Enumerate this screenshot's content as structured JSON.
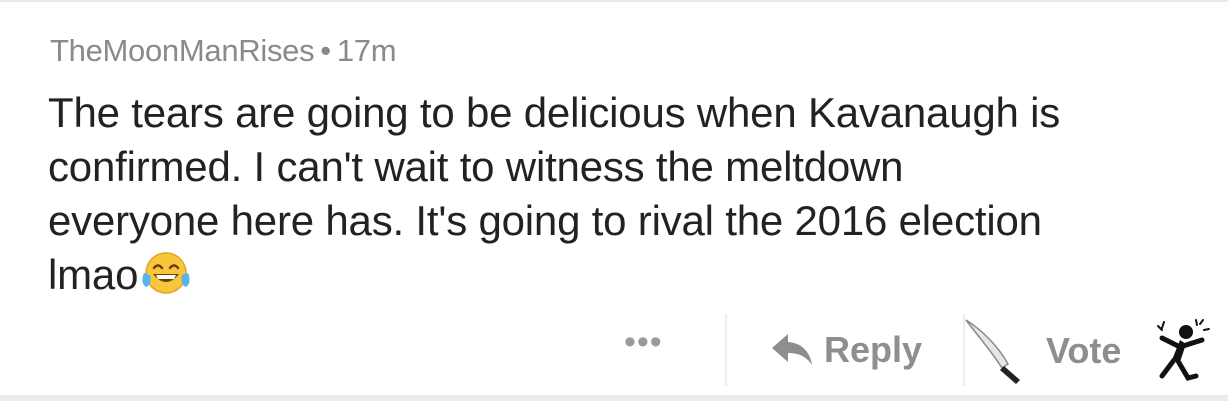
{
  "comment": {
    "author": "TheMoonManRises",
    "separator": "•",
    "age": "17m",
    "body_lines": [
      "The tears are going to be delicious when Kavanaugh is",
      "confirmed. I can't wait to witness the meltdown",
      "everyone here has. It's going to rival the 2016 election",
      "lmao"
    ],
    "emoji": "face-with-tears-of-joy"
  },
  "actions": {
    "more_label": "•••",
    "reply_label": "Reply",
    "vote_label": "Vote",
    "reply_icon": "reply-arrow-icon",
    "upvote_icon": "knife-icon",
    "downvote_icon": "dancing-figure-icon"
  },
  "colors": {
    "text_primary": "#222222",
    "text_meta": "#8a8a8a",
    "action_gray": "#8e8e8e",
    "divider": "#eeeeee"
  }
}
